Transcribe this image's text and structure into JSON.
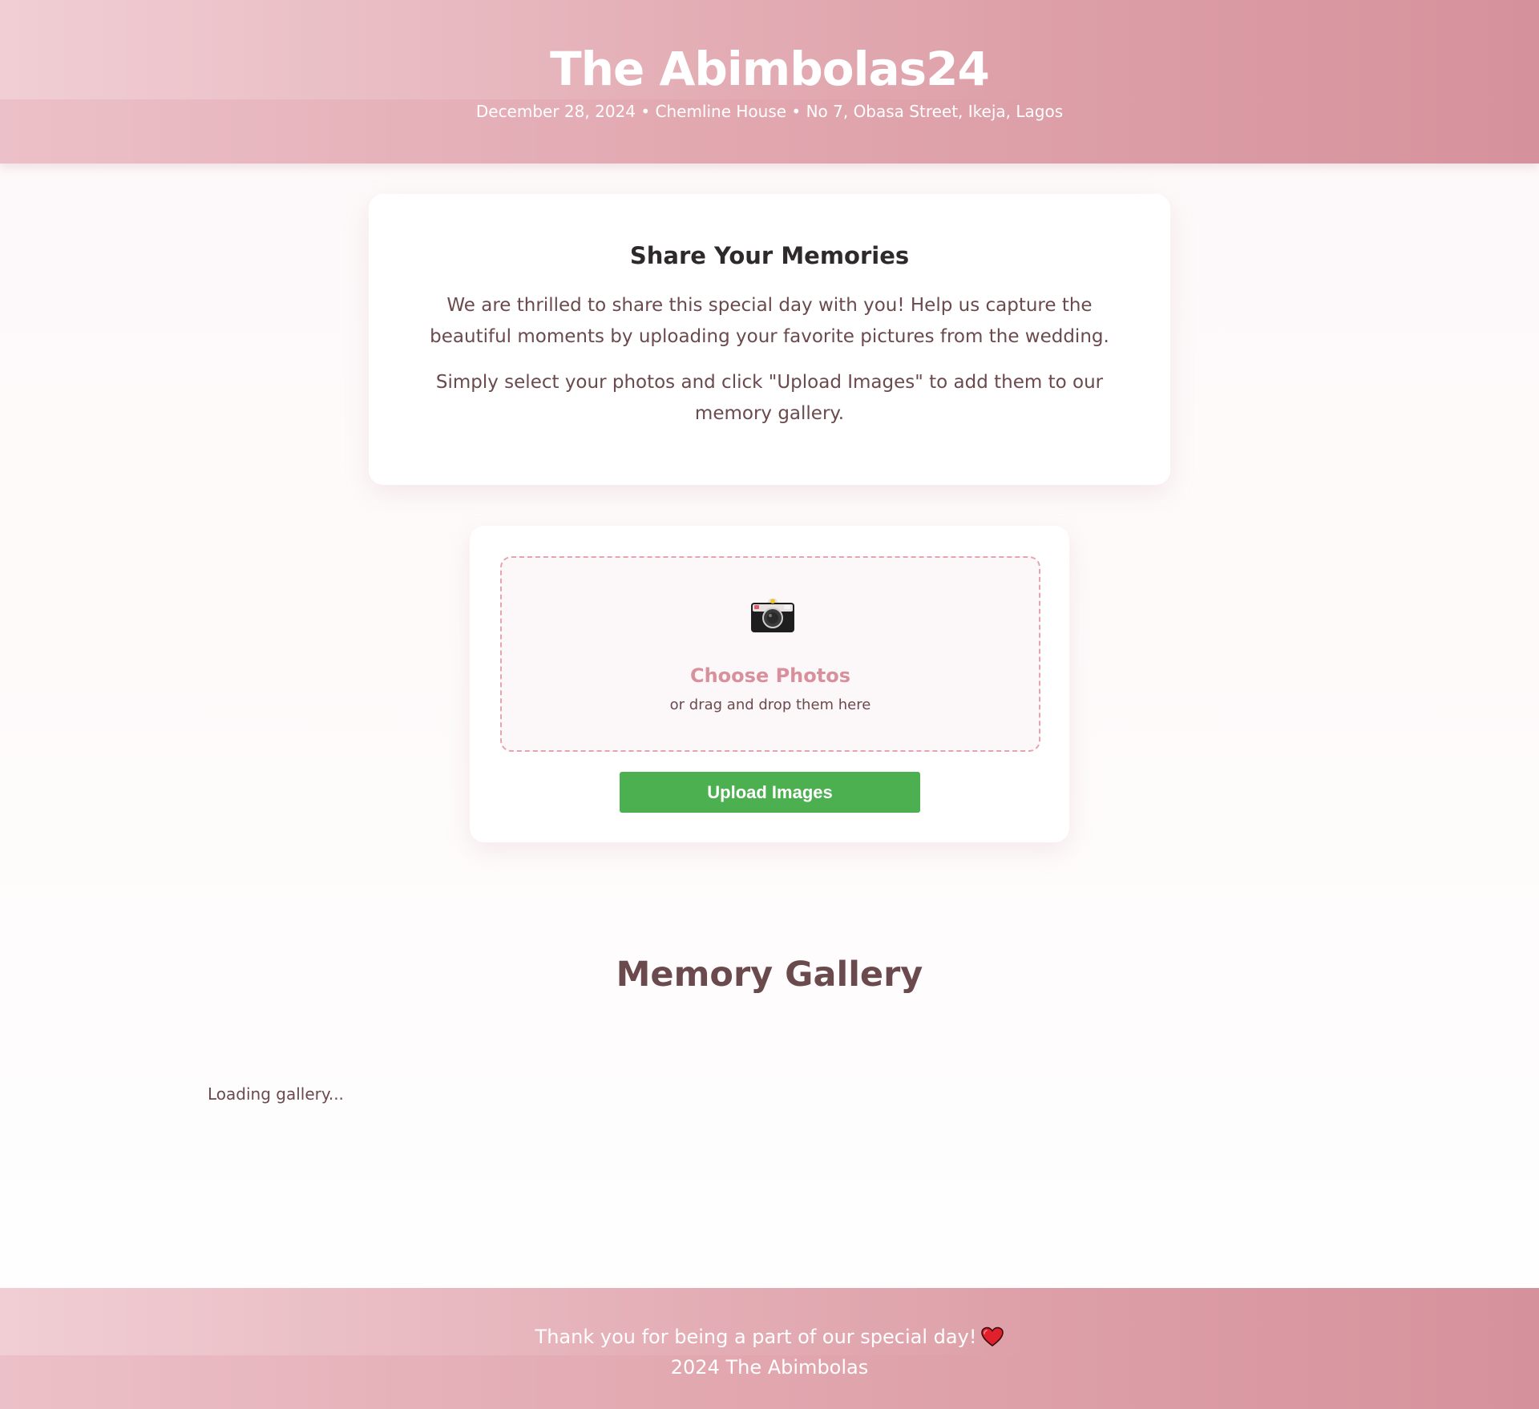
{
  "header": {
    "title": "The Abimbolas24",
    "subtitle": "December 28, 2024 • Chemline House • No 7, Obasa Street, Ikeja, Lagos"
  },
  "intro": {
    "heading": "Share Your Memories",
    "paragraph_1": "We are thrilled to share this special day with you! Help us capture the beautiful moments by uploading your favorite pictures from the wedding.",
    "paragraph_2": "Simply select your photos and click \"Upload Images\" to add them to our memory gallery."
  },
  "upload": {
    "icon": "camera-icon",
    "choose_label": "Choose Photos",
    "drop_hint": "or drag and drop them here",
    "button_label": "Upload Images"
  },
  "gallery": {
    "title": "Memory Gallery",
    "status": "Loading gallery..."
  },
  "footer": {
    "thanks": "Thank you for being a part of our special day!",
    "heart_icon": "heart-icon",
    "copyright": "2024 The Abimbolas"
  },
  "colors": {
    "header_gradient_start": "#ecc0c8",
    "header_gradient_end": "#d6929c",
    "accent_pink": "#d8909c",
    "button_green": "#4cb050",
    "text_brown": "#6b4a4e"
  }
}
